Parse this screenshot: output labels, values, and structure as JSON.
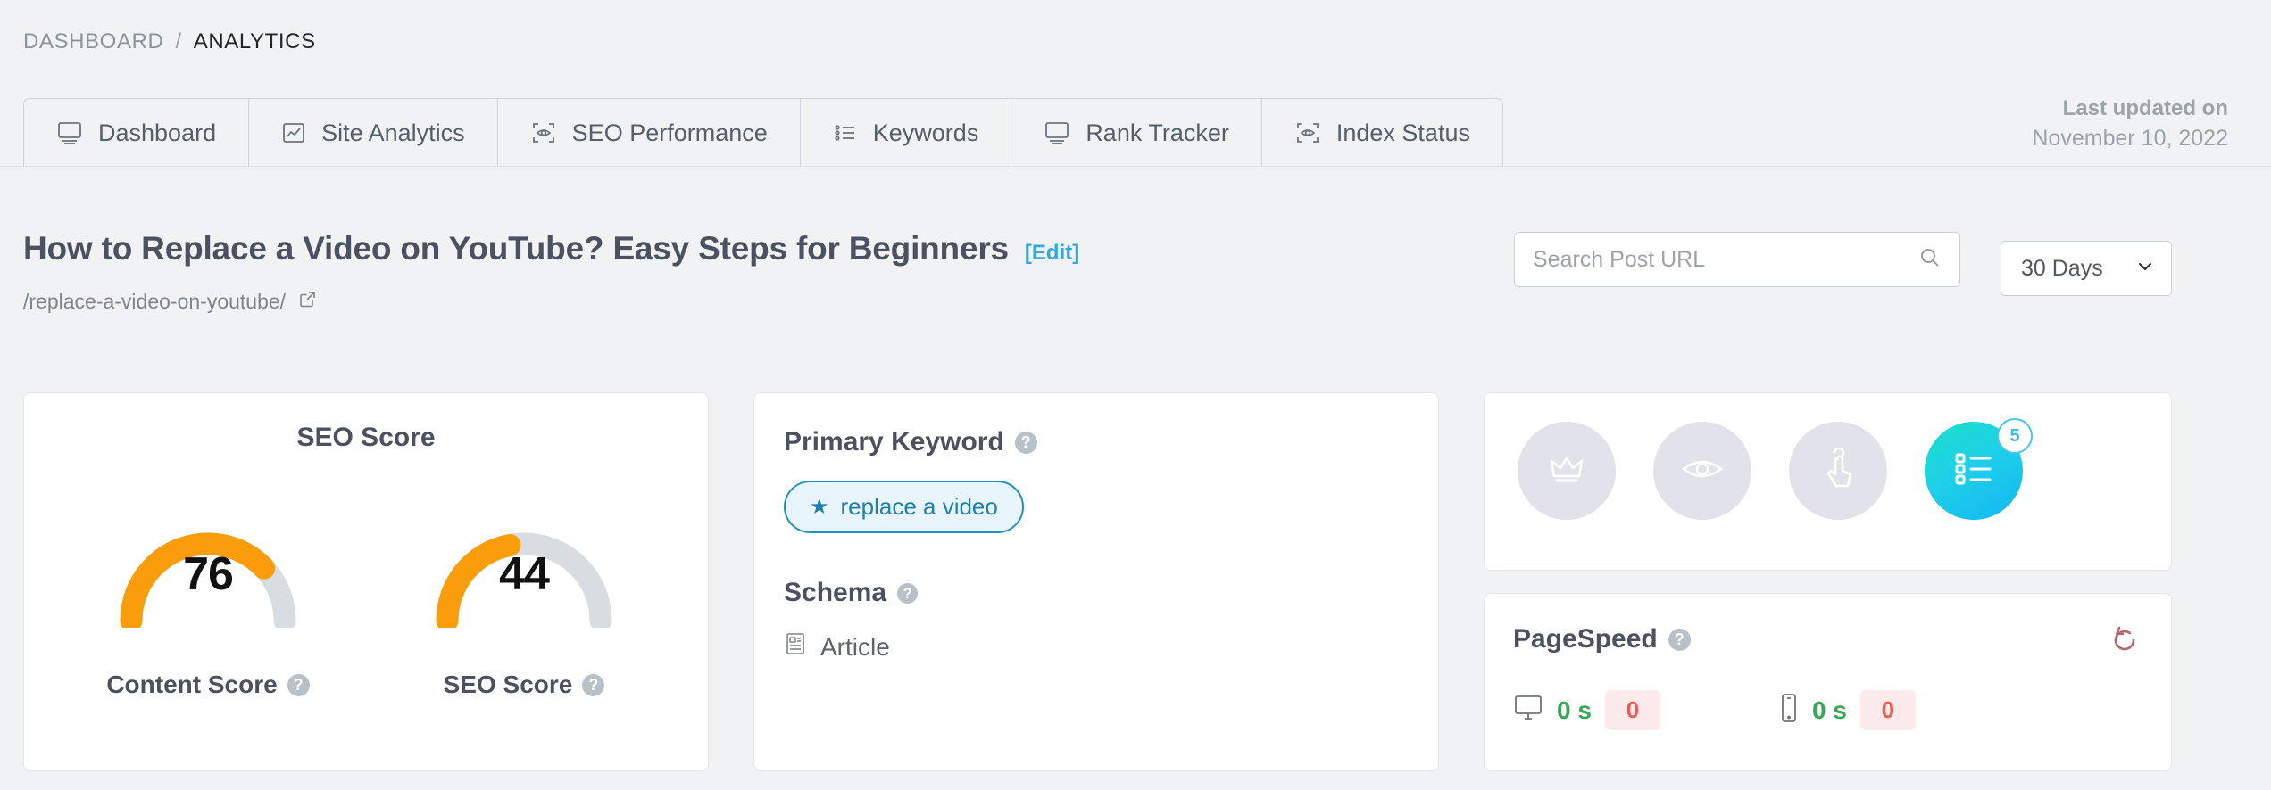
{
  "breadcrumb": {
    "parent": "DASHBOARD",
    "separator": "/",
    "current": "ANALYTICS"
  },
  "tabs": [
    {
      "label": "Dashboard",
      "icon": "monitor-icon"
    },
    {
      "label": "Site Analytics",
      "icon": "chart-box-icon"
    },
    {
      "label": "SEO Performance",
      "icon": "scan-eye-icon"
    },
    {
      "label": "Keywords",
      "icon": "list-icon"
    },
    {
      "label": "Rank Tracker",
      "icon": "monitor-icon"
    },
    {
      "label": "Index Status",
      "icon": "scan-eye-icon"
    }
  ],
  "last_updated": {
    "title": "Last updated on",
    "date": "November 10, 2022"
  },
  "post": {
    "title": "How to Replace a Video on YouTube? Easy Steps for Beginners",
    "edit_label": "[Edit]",
    "slug": "/replace-a-video-on-youtube/",
    "external_icon": "external-link-icon"
  },
  "search": {
    "placeholder": "Search Post URL",
    "value": "",
    "icon": "search-icon"
  },
  "date_range": {
    "selected": "30 Days",
    "icon": "chevron-down-icon"
  },
  "seo_card": {
    "title": "SEO Score",
    "gauges": [
      {
        "label": "Content Score",
        "value": "76",
        "percent": 76
      },
      {
        "label": "SEO Score",
        "value": "44",
        "percent": 44
      }
    ],
    "help_icon": "help-icon"
  },
  "keyword_card": {
    "primary_keyword_label": "Primary Keyword",
    "keyword": "replace a video",
    "keyword_star": "★",
    "schema_label": "Schema",
    "schema_value": "Article",
    "schema_icon": "article-icon",
    "help_icon": "help-icon"
  },
  "badges_card": {
    "items": [
      {
        "icon": "crown-icon",
        "active": false,
        "count": ""
      },
      {
        "icon": "eye-icon",
        "active": false,
        "count": ""
      },
      {
        "icon": "click-icon",
        "active": false,
        "count": ""
      },
      {
        "icon": "checklist-icon",
        "active": true,
        "count": "5"
      }
    ]
  },
  "pagespeed_card": {
    "title": "PageSpeed",
    "help_icon": "help-icon",
    "refresh_icon": "refresh-icon",
    "metrics": [
      {
        "device": "desktop-icon",
        "time": "0 s",
        "score": "0"
      },
      {
        "device": "mobile-icon",
        "time": "0 s",
        "score": "0"
      }
    ]
  },
  "colors": {
    "gauge_fill": "#f99d0d",
    "gauge_track": "#d8dde2",
    "accent_blue": "#2eaae0",
    "keyword_blue": "#1f7fae",
    "badge_cyan": "#12b8f2",
    "score_red": "#ee5b52",
    "time_green": "#35a853"
  }
}
